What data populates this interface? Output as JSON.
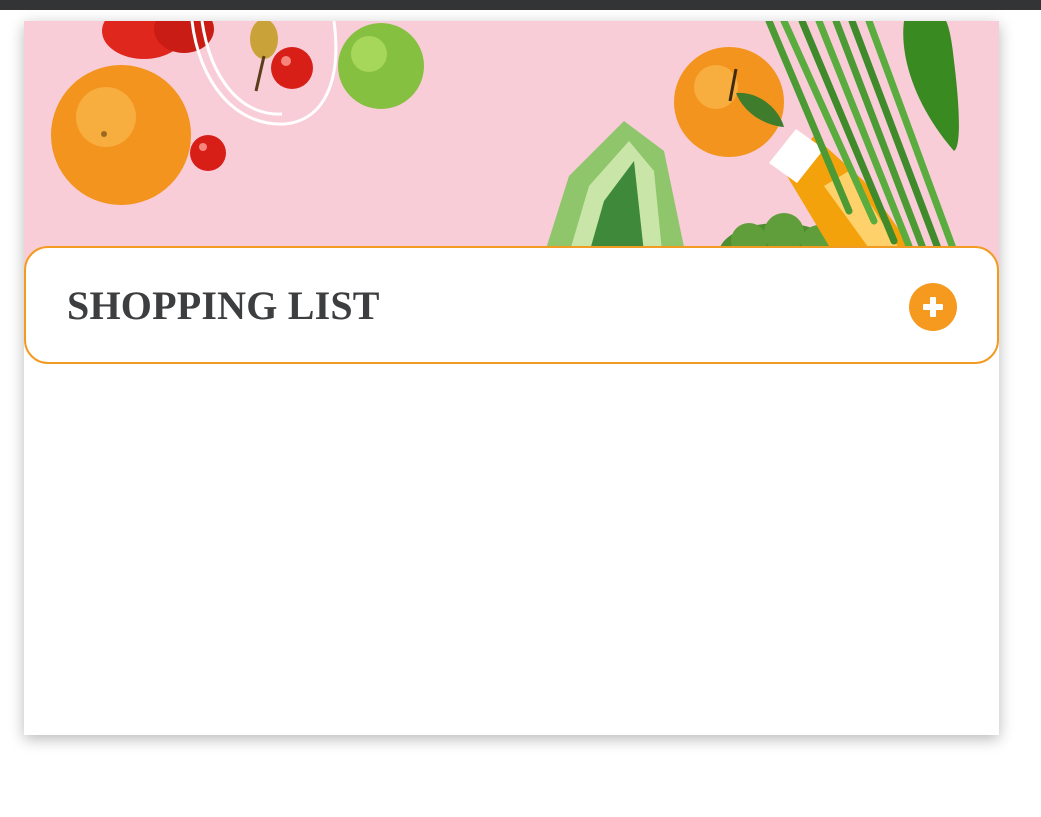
{
  "header": {
    "title": "SHOPPING LIST"
  },
  "toolbar": {
    "add_icon": "plus-circle-icon"
  },
  "colors": {
    "accent": "#f6991f",
    "title_text": "#3d3e40",
    "hero_background": "#f9cdd8",
    "top_bar": "#333436"
  },
  "items": []
}
